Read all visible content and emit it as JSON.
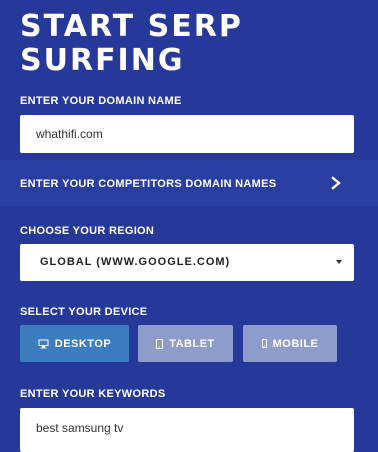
{
  "header": {
    "title_line1": "START SERP",
    "title_line2": "SURFING"
  },
  "domain": {
    "label": "ENTER YOUR DOMAIN NAME",
    "value": "whathifi.com"
  },
  "competitors": {
    "label": "ENTER YOUR COMPETITORS DOMAIN NAMES",
    "icon": "chevron-right-icon"
  },
  "region": {
    "label": "CHOOSE YOUR REGION",
    "selected": "GLOBAL (WWW.GOOGLE.COM)",
    "icon": "caret-down-icon"
  },
  "device": {
    "label": "SELECT YOUR DEVICE",
    "options": [
      {
        "label": "DESKTOP",
        "icon": "desktop-icon",
        "active": true
      },
      {
        "label": "TABLET",
        "icon": "tablet-icon",
        "active": false
      },
      {
        "label": "MOBILE",
        "icon": "mobile-icon",
        "active": false
      }
    ]
  },
  "keywords": {
    "label": "ENTER YOUR KEYWORDS",
    "value": "best samsung tv"
  },
  "colors": {
    "background": "#26399a",
    "active_button": "#3c7cc0",
    "inactive_button": "#8e9ccc"
  }
}
